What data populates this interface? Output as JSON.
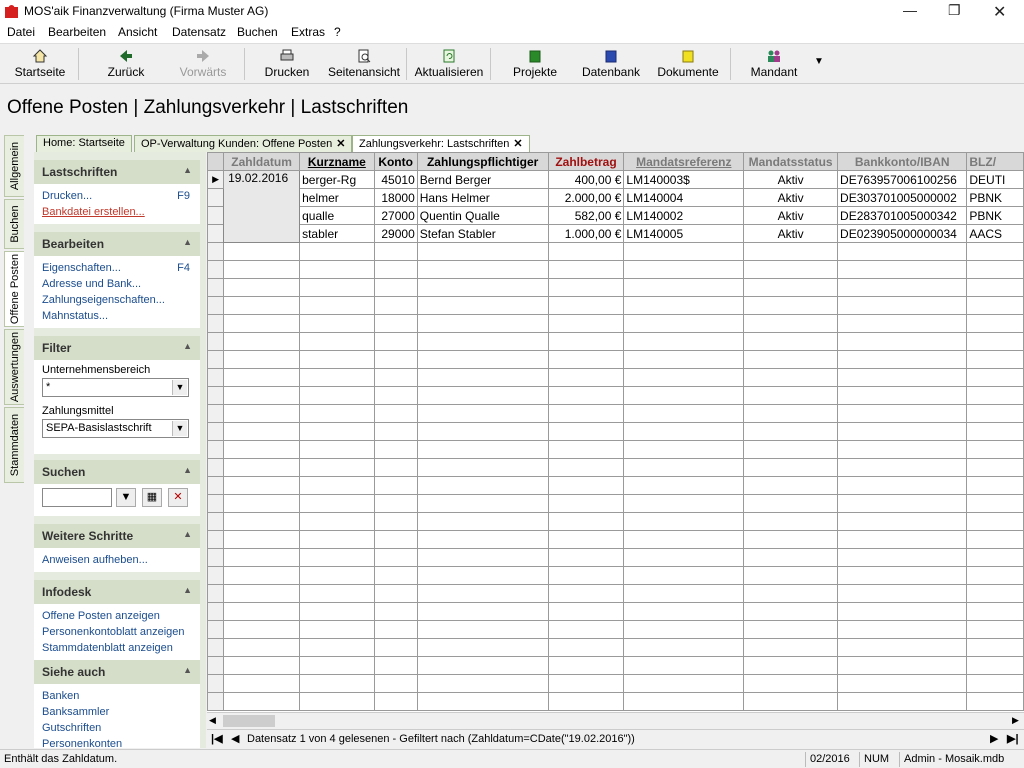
{
  "window": {
    "title": "MOS'aik Finanzverwaltung (Firma Muster AG)"
  },
  "menu": [
    "Datei",
    "Bearbeiten",
    "Ansicht",
    "Datensatz",
    "Buchen",
    "Extras",
    "?"
  ],
  "toolbar": {
    "startseite": "Startseite",
    "zurueck": "Zurück",
    "vorwaerts": "Vorwärts",
    "drucken": "Drucken",
    "seitenansicht": "Seitenansicht",
    "aktualisieren": "Aktualisieren",
    "projekte": "Projekte",
    "datenbank": "Datenbank",
    "dokumente": "Dokumente",
    "mandant": "Mandant"
  },
  "page_title": "Offene Posten | Zahlungsverkehr | Lastschriften",
  "vertical_tabs": [
    "Allgemein",
    "Buchen",
    "Offene Posten",
    "Auswertungen",
    "Stammdaten"
  ],
  "tabs": [
    {
      "label": "Home: Startseite"
    },
    {
      "label": "OP-Verwaltung Kunden: Offene Posten"
    },
    {
      "label": "Zahlungsverkehr: Lastschriften"
    }
  ],
  "sidebar": {
    "lastschriften": {
      "title": "Lastschriften",
      "items": [
        {
          "label": "Drucken...",
          "key": "F9"
        },
        {
          "label": "Bankdatei erstellen...",
          "key": ""
        }
      ]
    },
    "bearbeiten": {
      "title": "Bearbeiten",
      "items": [
        {
          "label": "Eigenschaften...",
          "key": "F4"
        },
        {
          "label": "Adresse und Bank...",
          "key": ""
        },
        {
          "label": "Zahlungseigenschaften...",
          "key": ""
        },
        {
          "label": "Mahnstatus...",
          "key": ""
        }
      ]
    },
    "filter": {
      "title": "Filter",
      "label1": "Unternehmensbereich",
      "value1": "*",
      "label2": "Zahlungsmittel",
      "value2": "SEPA-Basislastschrift"
    },
    "suchen": {
      "title": "Suchen",
      "value": ""
    },
    "weitere": {
      "title": "Weitere Schritte",
      "items": [
        {
          "label": "Anweisen aufheben..."
        }
      ]
    },
    "infodesk": {
      "title": "Infodesk",
      "items": [
        {
          "label": "Offene Posten anzeigen"
        },
        {
          "label": "Personenkontoblatt anzeigen"
        },
        {
          "label": "Stammdatenblatt anzeigen"
        }
      ]
    },
    "siehe": {
      "title": "Siehe auch",
      "items": [
        {
          "label": "Banken"
        },
        {
          "label": "Banksammler"
        },
        {
          "label": "Gutschriften"
        },
        {
          "label": "Personenkonten"
        }
      ]
    }
  },
  "table": {
    "headers": [
      "Zahldatum",
      "Kurzname",
      "Konto",
      "Zahlungspflichtiger",
      "Zahlbetrag",
      "Mandatsreferenz",
      "Mandatsstatus",
      "Bankkonto/IBAN",
      "BLZ/"
    ],
    "group_date": "19.02.2016",
    "rows": [
      [
        "berger-Rg",
        "45010",
        "Bernd Berger",
        "400,00 €",
        "LM140003$",
        "Aktiv",
        "DE763957006100256",
        "DEUTI"
      ],
      [
        "helmer",
        "18000",
        "Hans Helmer",
        "2.000,00 €",
        "LM140004",
        "Aktiv",
        "DE303701005000002",
        "PBNK"
      ],
      [
        "qualle",
        "27000",
        "Quentin Qualle",
        "582,00 €",
        "LM140002",
        "Aktiv",
        "DE283701005000342",
        "PBNK"
      ],
      [
        "stabler",
        "29000",
        "Stefan Stabler",
        "1.000,00 €",
        "LM140005",
        "Aktiv",
        "DE023905000000034",
        "AACS"
      ]
    ]
  },
  "nav": {
    "text": "Datensatz 1 von 4 gelesenen - Gefiltert nach (Zahldatum=CDate(\"19.02.2016\"))"
  },
  "status": {
    "msg": "Enthält das Zahldatum.",
    "period": "02/2016",
    "num": "NUM",
    "user": "Admin - Mosaik.mdb"
  }
}
